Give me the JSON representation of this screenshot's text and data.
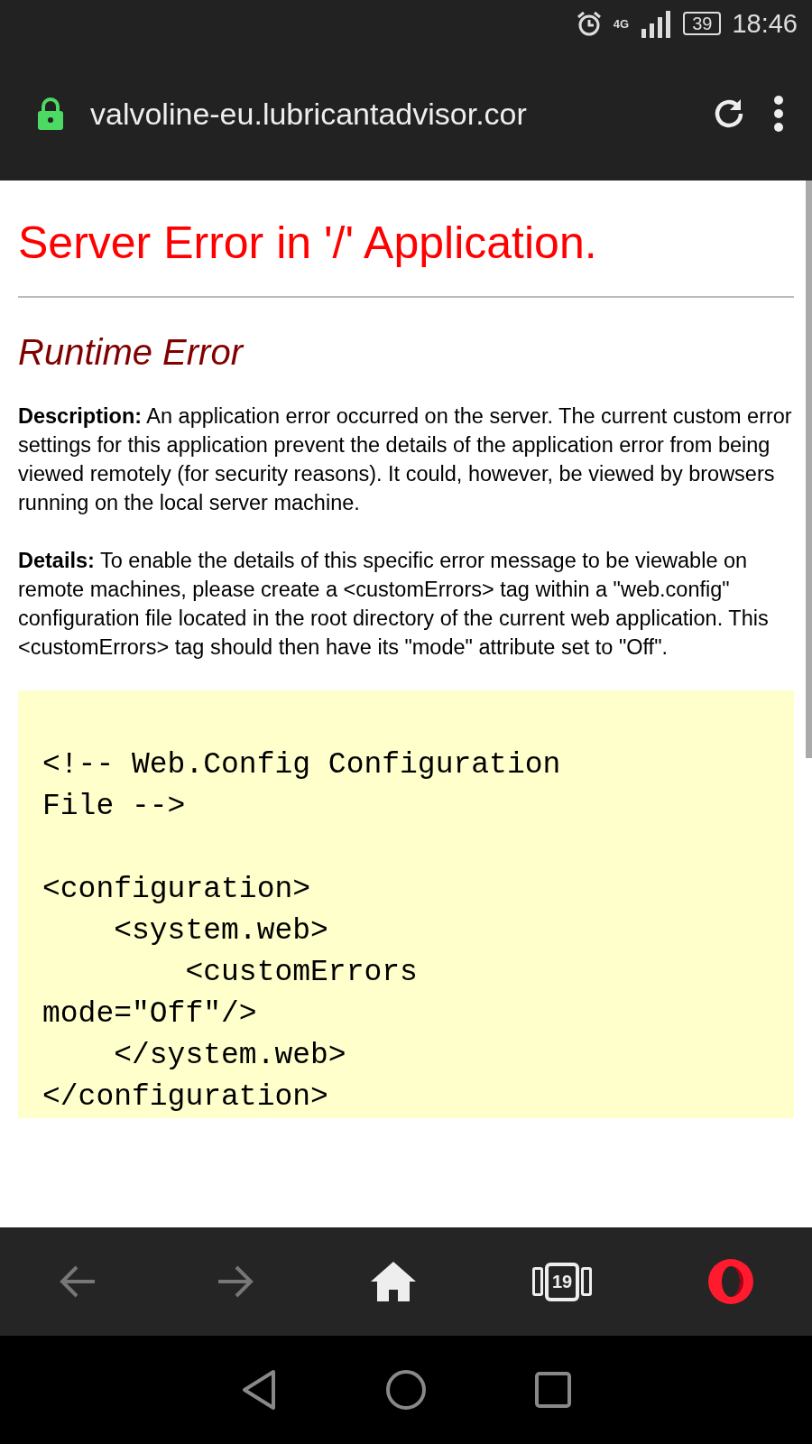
{
  "status_bar": {
    "network": "4G",
    "battery": "39",
    "time": "18:46"
  },
  "address_bar": {
    "url": "valvoline-eu.lubricantadvisor.cor"
  },
  "page": {
    "title": "Server Error in '/' Application.",
    "subtitle": "Runtime Error",
    "paragraphs": [
      "**Description:** An application error occurred on the server. The current custom error settings for this application prevent the details of the application error from being viewed remotely (for security reasons). It could, however, be viewed by browsers running on the local server machine.",
      "**Details:** To enable the details of this specific error message to be viewable on remote machines, please create a <customErrors> tag within a \"web.config\" configuration file located in the root directory of the current web application. This <customErrors> tag should then have its \"mode\" attribute set to \"Off\"."
    ],
    "code_groups": [
      [
        "<!-- Web.Config Configuration",
        "File -->"
      ],
      [
        "<configuration>",
        "    <system.web>",
        "        <customErrors",
        "mode=\"Off\"/>",
        "    </system.web>",
        "</configuration>"
      ]
    ]
  },
  "toolbar": {
    "back": {
      "disabled": true
    },
    "forward": {
      "disabled": true
    },
    "tabs_count": "19"
  }
}
